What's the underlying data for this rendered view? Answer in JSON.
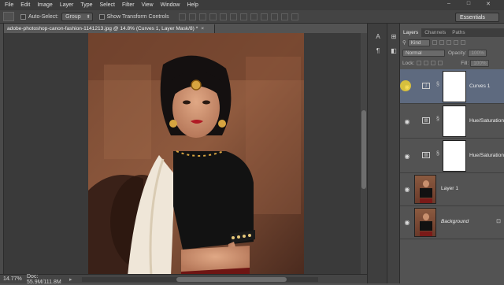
{
  "menu": [
    "File",
    "Edit",
    "Image",
    "Layer",
    "Type",
    "Select",
    "Filter",
    "View",
    "Window",
    "Help"
  ],
  "window_controls": [
    "–",
    "□",
    "✕"
  ],
  "options": {
    "auto_select_label": "Auto-Select:",
    "auto_select_value": "Group",
    "show_transform_label": "Show Transform Controls",
    "workspace": "Essentials"
  },
  "document": {
    "tab_title": "adobe-photoshop-canon-fashion-1141213.jpg @ 14.8% (Curves 1, Layer Mask/8) *",
    "close": "×"
  },
  "status": {
    "zoom": "14.77%",
    "doc_size": "Doc: 55.9M/111.8M",
    "arrow": "▸"
  },
  "panel": {
    "tabs": [
      "Layers",
      "Channels",
      "Paths"
    ],
    "kind": "Kind",
    "blend_mode": "Normal",
    "opacity_label": "Opacity:",
    "opacity_value": "100%",
    "lock_label": "Lock:",
    "fill_label": "Fill:",
    "fill_value": "100%"
  },
  "layers": [
    {
      "name": "Curves 1",
      "type": "curves",
      "selected": true
    },
    {
      "name": "Hue/Saturation",
      "type": "hue-sat",
      "selected": false
    },
    {
      "name": "Hue/Saturation",
      "type": "hue-sat",
      "selected": false
    },
    {
      "name": "Layer 1",
      "type": "pixel",
      "selected": false
    },
    {
      "name": "Background",
      "type": "pixel",
      "selected": false
    }
  ],
  "icons": {
    "eye": "eye-icon",
    "chain": "chain-icon",
    "fx": "fx-icon"
  },
  "colors": {
    "selected_layer": "#5e6a7f",
    "panel_bg": "#535353"
  }
}
